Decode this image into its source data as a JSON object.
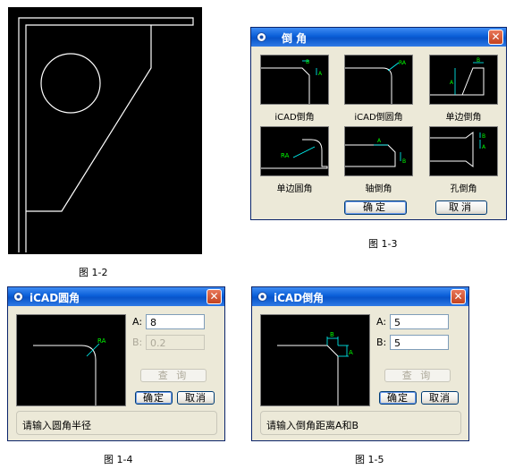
{
  "figure_1_2": {
    "caption": "图 1-2"
  },
  "dialog_1_3": {
    "caption": "图 1-3",
    "title": "倒  角",
    "options": [
      {
        "label": "iCAD倒角",
        "tag": "B"
      },
      {
        "label": "iCAD倒圆角",
        "tag": "RA"
      },
      {
        "label": "单边倒角",
        "tag": "B"
      },
      {
        "label": "单边圆角",
        "tag": "RA"
      },
      {
        "label": "轴倒角",
        "tag": "A"
      },
      {
        "label": "孔倒角",
        "tag": "B"
      }
    ],
    "ok_label": "确定",
    "cancel_label": "取消"
  },
  "dialog_1_4": {
    "caption": "图 1-4",
    "title": "iCAD圆角",
    "preview_tag": "RA",
    "field_a_label": "A:",
    "field_a_value": "8",
    "field_b_label": "B:",
    "field_b_value": "0.2",
    "query_label": "查 询",
    "ok_label": "确定",
    "cancel_label": "取消",
    "status": "请输入圆角半径"
  },
  "dialog_1_5": {
    "caption": "图 1-5",
    "title": "iCAD倒角",
    "field_a_label": "A:",
    "field_a_value": "5",
    "field_b_label": "B:",
    "field_b_value": "5",
    "query_label": "查 询",
    "ok_label": "确定",
    "cancel_label": "取消",
    "status": "请输入倒角距离A和B"
  }
}
